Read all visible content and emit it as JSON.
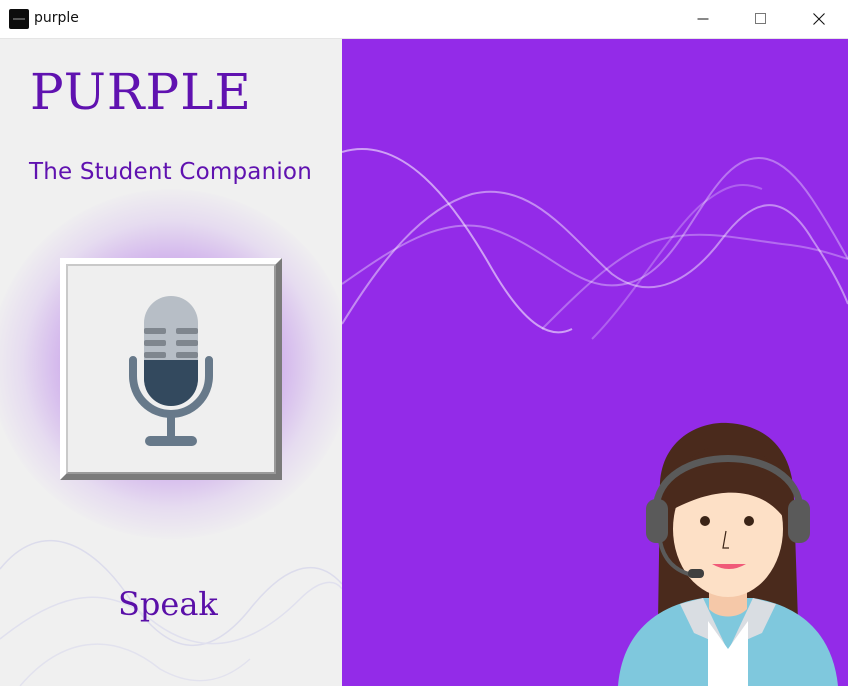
{
  "window": {
    "title": "purple",
    "icon": "app-icon",
    "controls": [
      "minimize-icon",
      "maximize-icon",
      "close-icon"
    ]
  },
  "sidebar": {
    "app_name": "PURPLE",
    "tagline": "The Student Companion",
    "mic_icon": "microphone-icon",
    "speak_label": "Speak"
  },
  "hero": {
    "illustration": "support-agent-headset-illustration",
    "decoration": "wave-lines"
  },
  "colors": {
    "accent": "#932be8",
    "text": "#6012b0",
    "panel": "#f0f0f0"
  }
}
